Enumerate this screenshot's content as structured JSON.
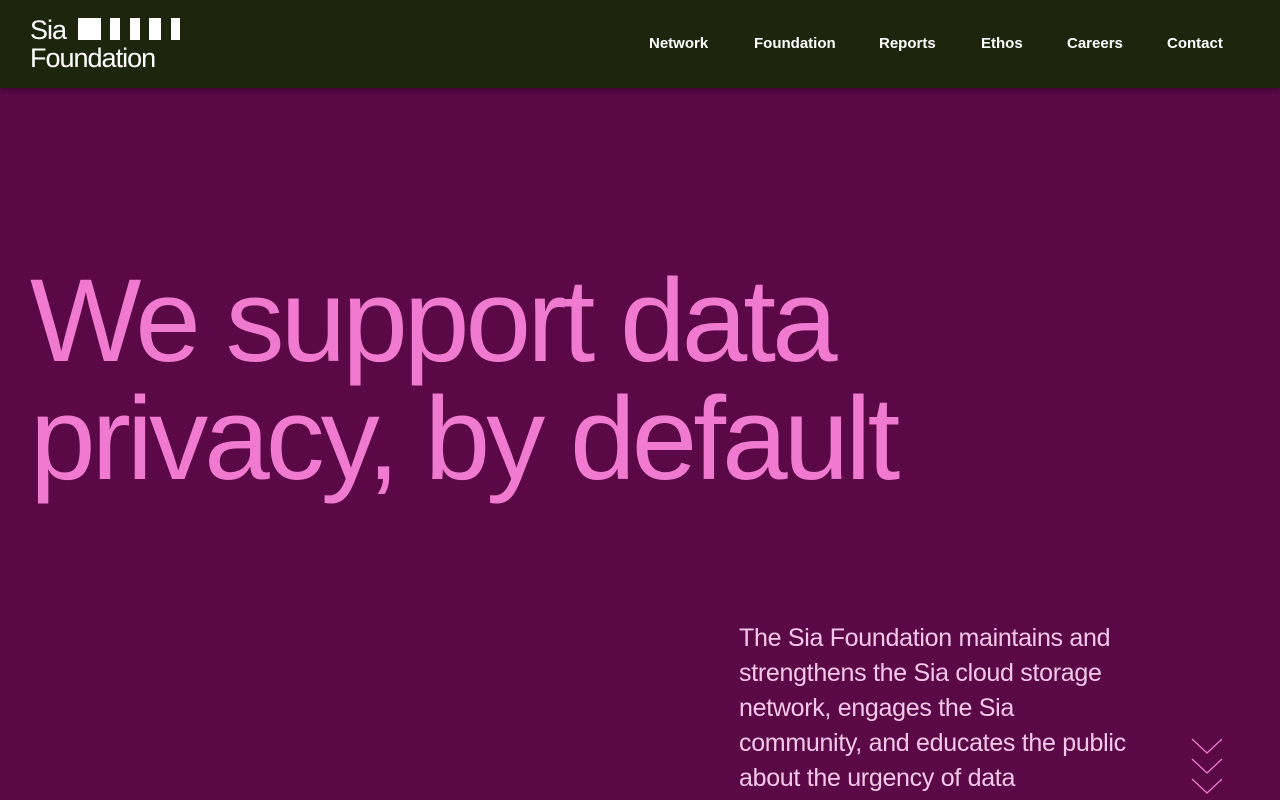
{
  "brand": {
    "name_line1": "Sia",
    "name_line2": "Foundation"
  },
  "nav": {
    "items": [
      {
        "label": "Network"
      },
      {
        "label": "Foundation"
      },
      {
        "label": "Reports"
      },
      {
        "label": "Ethos"
      },
      {
        "label": "Careers"
      },
      {
        "label": "Contact"
      }
    ]
  },
  "hero": {
    "title_line1": "We support data",
    "title_line2": "privacy, by default",
    "description": "The Sia Foundation maintains and strengthens the Sia cloud storage network, engages the Sia community, and educates the public about the urgency of data"
  },
  "scroll": {
    "icon": "chevron-down-icon"
  },
  "colors": {
    "header_bg": "#1e250d",
    "page_bg": "#5a0846",
    "title": "#f07acf",
    "description": "#f5c8ea",
    "nav_text": "#ffffff"
  }
}
